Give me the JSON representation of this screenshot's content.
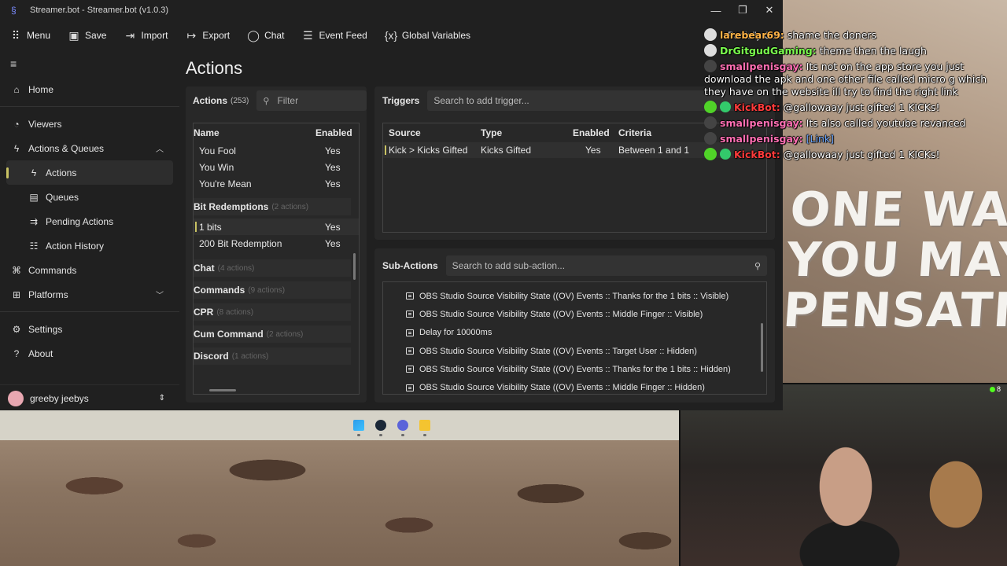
{
  "window": {
    "title": "Streamer.bot - Streamer.bot (v1.0.3)",
    "controls": {
      "minimize": "—",
      "maximize": "❐",
      "close": "✕"
    }
  },
  "toolbar": {
    "menu": "Menu",
    "save": "Save",
    "import": "Import",
    "export": "Export",
    "chat": "Chat",
    "event_feed": "Event Feed",
    "global_variables": "Global Variables",
    "connection_status": "Partially Conn"
  },
  "sidebar": {
    "items": [
      {
        "label": "Home"
      },
      {
        "label": "Viewers"
      },
      {
        "label": "Actions & Queues"
      },
      {
        "label": "Actions"
      },
      {
        "label": "Queues"
      },
      {
        "label": "Pending Actions"
      },
      {
        "label": "Action History"
      },
      {
        "label": "Commands"
      },
      {
        "label": "Platforms"
      },
      {
        "label": "Settings"
      },
      {
        "label": "About"
      }
    ],
    "profile_name": "greeby jeebys"
  },
  "main": {
    "title": "Actions",
    "actions": {
      "label": "Actions",
      "count": "(253)",
      "filter_placeholder": "Filter",
      "col_name": "Name",
      "col_enabled": "Enabled",
      "rows_top": [
        {
          "name": "You Fool",
          "enabled": "Yes"
        },
        {
          "name": "You Win",
          "enabled": "Yes"
        },
        {
          "name": "You're Mean",
          "enabled": "Yes"
        }
      ],
      "group_bits": {
        "name": "Bit Redemptions",
        "count": "(2 actions)"
      },
      "rows_bits": [
        {
          "name": "1 bits",
          "enabled": "Yes"
        },
        {
          "name": "200 Bit Redemption",
          "enabled": "Yes"
        }
      ],
      "groups": [
        {
          "name": "Chat",
          "count": "(4 actions)"
        },
        {
          "name": "Commands",
          "count": "(9 actions)"
        },
        {
          "name": "CPR",
          "count": "(8 actions)"
        },
        {
          "name": "Cum Command",
          "count": "(2 actions)"
        },
        {
          "name": "Discord",
          "count": "(1 actions)"
        }
      ]
    },
    "triggers": {
      "label": "Triggers",
      "search_placeholder": "Search to add trigger...",
      "columns": {
        "source": "Source",
        "type": "Type",
        "enabled": "Enabled",
        "criteria": "Criteria"
      },
      "rows": [
        {
          "source": "Kick > Kicks Gifted",
          "type": "Kicks Gifted",
          "enabled": "Yes",
          "criteria": "Between 1 and 1"
        }
      ]
    },
    "subactions": {
      "label": "Sub-Actions",
      "search_placeholder": "Search to add sub-action...",
      "rows": [
        "OBS Studio Source Visibility State ((OV) Events :: Thanks for the 1 bits :: Visible)",
        "OBS Studio Source Visibility State ((OV) Events :: Middle Finger :: Visible)",
        "Delay for 10000ms",
        "OBS Studio Source Visibility State ((OV) Events :: Target User :: Hidden)",
        "OBS Studio Source Visibility State ((OV) Events :: Thanks for the 1 bits :: Hidden)",
        "OBS Studio Source Visibility State ((OV) Events :: Middle Finger :: Hidden)"
      ]
    }
  },
  "chat": {
    "messages": [
      {
        "user": "larebear69:",
        "text": "shame the doners",
        "color": "#ffb347",
        "avatar": "gray"
      },
      {
        "user": "DrGitgudGaming:",
        "text": "theme then the laugh",
        "color": "#7cff4f",
        "avatar": "gray"
      },
      {
        "user": "smallpenisgay:",
        "text": "Its not on the app store you just download the apk and one other file called micro g which they have on the website ill try to find the right link",
        "color": "#ff6fb3",
        "avatar": "dark"
      },
      {
        "user": "KickBot:",
        "text": "@gallowaay just gifted 1 KICKs!",
        "color": "#ff3b3b",
        "avatar": "green"
      },
      {
        "user": "smallpenisgay:",
        "text": "Its also called youtube revanced",
        "color": "#ff6fb3",
        "avatar": "dark"
      },
      {
        "user": "smallpenisgay:",
        "text": "[Link]",
        "color": "#ff6fb3",
        "avatar": "dark",
        "text_color": "#6ea8ff"
      },
      {
        "user": "KickBot:",
        "text": "@gallowaay just gifted 1 KICKs!",
        "color": "#ff3b3b",
        "avatar": "green"
      }
    ]
  },
  "overlay": {
    "hill_text": [
      "ONE WAS",
      "YOU MAY",
      "PENSATION"
    ],
    "pip_count": "8"
  },
  "colors": {
    "accent": "#c9c263",
    "window_bg": "#202020",
    "panel_bg": "#282828"
  }
}
